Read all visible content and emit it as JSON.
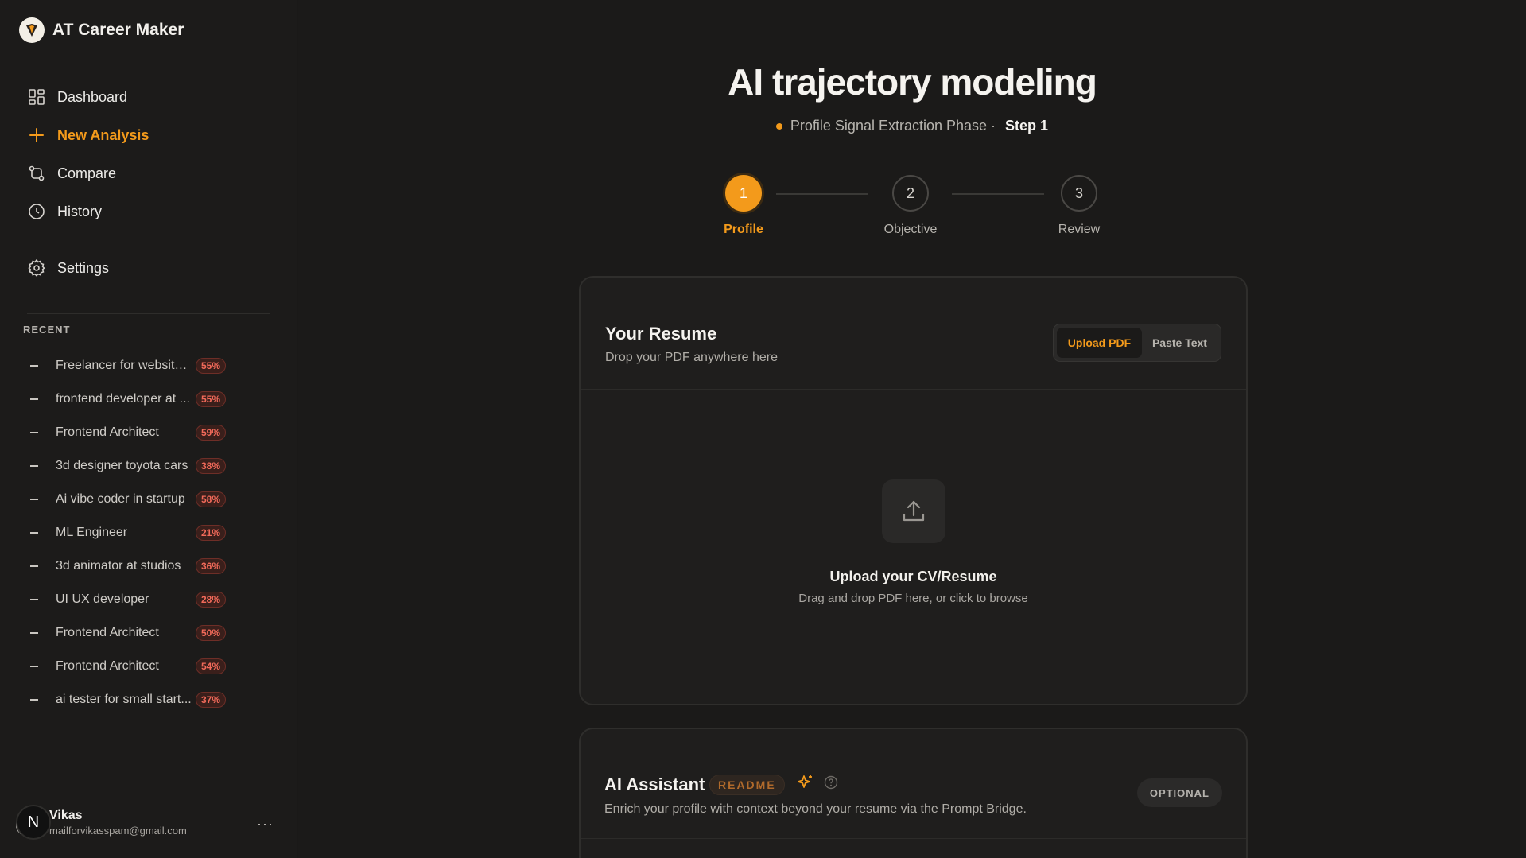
{
  "app": {
    "title": "AT Career Maker"
  },
  "nav": {
    "items": [
      {
        "label": "Dashboard",
        "icon": "dashboard-icon"
      },
      {
        "label": "New Analysis",
        "icon": "plus-icon"
      },
      {
        "label": "Compare",
        "icon": "compare-icon"
      },
      {
        "label": "History",
        "icon": "clock-icon"
      }
    ],
    "settings": {
      "label": "Settings",
      "icon": "gear-icon"
    }
  },
  "recent": {
    "title": "RECENT",
    "items": [
      {
        "label": "Freelancer for website ...",
        "score": "55%"
      },
      {
        "label": "frontend developer at ...",
        "score": "55%"
      },
      {
        "label": "Frontend Architect",
        "score": "59%"
      },
      {
        "label": "3d designer toyota cars",
        "score": "38%"
      },
      {
        "label": "Ai vibe coder in startup",
        "score": "58%"
      },
      {
        "label": "ML Engineer",
        "score": "21%"
      },
      {
        "label": "3d animator at studios",
        "score": "36%"
      },
      {
        "label": "UI UX developer",
        "score": "28%"
      },
      {
        "label": "Frontend Architect",
        "score": "50%"
      },
      {
        "label": "Frontend Architect",
        "score": "54%"
      },
      {
        "label": "ai tester for small start...",
        "score": "37%"
      }
    ]
  },
  "user": {
    "initial": "N",
    "name": "Vikas",
    "email": "mailforvikasspam@gmail.com",
    "more": "···"
  },
  "page": {
    "title": "AI trajectory modeling",
    "phase": "Profile Signal Extraction Phase ·",
    "step": "Step 1"
  },
  "stepper": {
    "steps": [
      {
        "number": "1",
        "label": "Profile"
      },
      {
        "number": "2",
        "label": "Objective"
      },
      {
        "number": "3",
        "label": "Review"
      }
    ],
    "current": 1
  },
  "resume": {
    "title": "Your Resume",
    "subtitle": "Drop your PDF anywhere here",
    "tab_upload": "Upload PDF",
    "tab_paste": "Paste Text",
    "drop_title": "Upload your CV/Resume",
    "drop_sub": "Drag and drop PDF here, or click to browse"
  },
  "assistant": {
    "title": "AI Assistant",
    "badge": "README",
    "subtitle": "Enrich your profile with context beyond your resume via the Prompt Bridge.",
    "optional": "OPTIONAL"
  },
  "colors": {
    "accent": "#f39a1b",
    "danger": "#f26a5a",
    "background": "#1b1a19"
  }
}
